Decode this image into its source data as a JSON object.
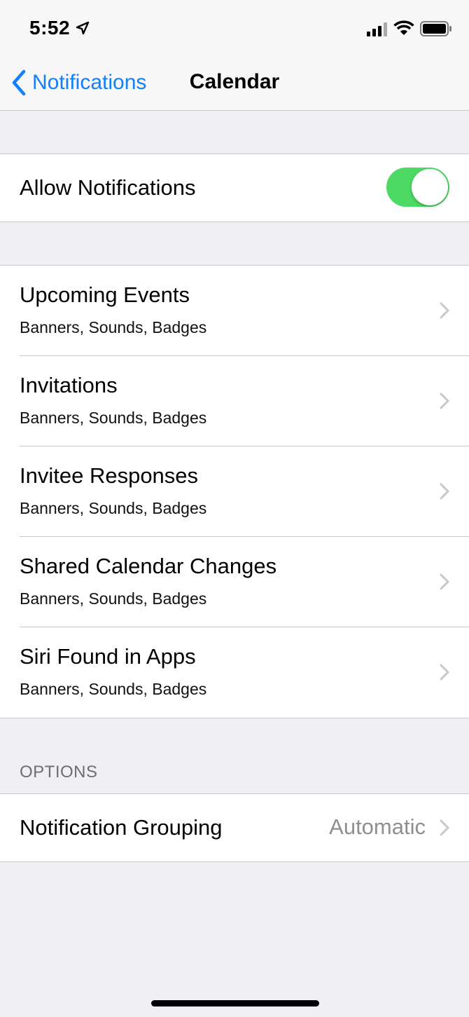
{
  "status_bar": {
    "time": "5:52",
    "icons": [
      "location-arrow-icon",
      "cellular-signal-icon",
      "wifi-icon",
      "battery-icon"
    ]
  },
  "nav": {
    "back_label": "Notifications",
    "title": "Calendar"
  },
  "allow": {
    "label": "Allow Notifications",
    "enabled": true,
    "toggle_color": "#4cd964"
  },
  "items": [
    {
      "title": "Upcoming Events",
      "subtitle": "Banners, Sounds, Badges"
    },
    {
      "title": "Invitations",
      "subtitle": "Banners, Sounds, Badges"
    },
    {
      "title": "Invitee Responses",
      "subtitle": "Banners, Sounds, Badges"
    },
    {
      "title": "Shared Calendar Changes",
      "subtitle": "Banners, Sounds, Badges"
    },
    {
      "title": "Siri Found in Apps",
      "subtitle": "Banners, Sounds, Badges"
    }
  ],
  "options": {
    "header": "OPTIONS",
    "grouping_label": "Notification Grouping",
    "grouping_value": "Automatic"
  },
  "colors": {
    "accent": "#147efb",
    "background": "#efeff4",
    "secondary_text": "#8e8e93"
  }
}
